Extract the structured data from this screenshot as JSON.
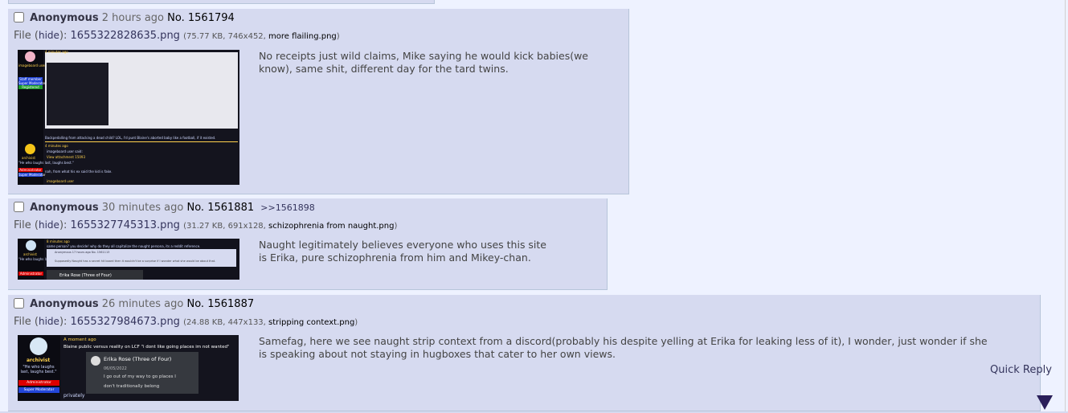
{
  "posts": [
    {
      "name": "Anonymous",
      "date": "2 hours ago",
      "no_label": "No.",
      "number": "1561794",
      "file_label": "File",
      "hide": "hide",
      "filename": "1655322828635.png",
      "size": "75.77 KB",
      "dims": "746x452",
      "orig": "more flailing.png",
      "comment": "No receipts just wild claims, Mike saying he would kick babies(we know), same shit, different day for the tard twins."
    },
    {
      "name": "Anonymous",
      "date": "30 minutes ago",
      "no_label": "No.",
      "number": "1561881",
      "backlink": ">>1561898",
      "file_label": "File",
      "hide": "hide",
      "filename": "1655327745313.png",
      "size": "31.27 KB",
      "dims": "691x128",
      "orig": "schizophrenia from naught.png",
      "comment": "Naught legitimately believes everyone who uses this site is Erika, pure schizophrenia from him and Mikey-chan."
    },
    {
      "name": "Anonymous",
      "date": "26 minutes ago",
      "no_label": "No.",
      "number": "1561887",
      "file_label": "File",
      "hide": "hide",
      "filename": "1655327984673.png",
      "size": "24.88 KB",
      "dims": "447x133",
      "orig": "stripping context.png",
      "comment": "Samefag, here we see naught strip context from a discord(probably his despite yelling at Erika for leaking less of it), I wonder, just wonder if she is speaking about not staying in hugboxes that cater to her own views."
    }
  ],
  "thumb1": {
    "time": "4 minutes ago",
    "user": "imageboard user",
    "line1": "Backpedalling from attacking a dead child? LOL, I'd punt Blaine's aborted baby like a football, if it existed.",
    "user2": "archivist",
    "quote": "\"He who laughs last, laughs best.\"",
    "badge_admin": "Administrator",
    "badge_mod": "Super Moderator",
    "badge_staff": "Staff member",
    "badge_reg": "Registered",
    "time2": "4 minutes ago",
    "said": "imageboard user said:",
    "view": "View attachment 15093",
    "line2": "nah, from what his ex said the kid is fake.",
    "footer": "imageboard user"
  },
  "thumb2": {
    "time": "8 minutes ago",
    "line1": "same person? you decide! why do they all capitalize the naught persona, its a reddit reference.",
    "user": "archivist",
    "quote": "\"He who laughs last, laughs best.\"",
    "badge_admin": "Administrator",
    "post_meta": "Anonymous 17 hours ago No. 1561113",
    "post_text": "Supposedly Naught has a secret hit board then it wouldn't be a surprise if I wonder what she would be about that.",
    "card": "Erika Rose (Three of Four)"
  },
  "thumb3": {
    "time": "A moment ago",
    "title": "Blaine public versus reality on LCF \"i dont like going places im not wanted\"",
    "user": "archivist",
    "quote": "\"He who laughs last, laughs best.\"",
    "badge_admin": "Administrator",
    "badge_mod": "Super Moderator",
    "card_name": "Erika Rose (Three of Four)",
    "card_date": "06/05/2022",
    "card_line1": "I go out of my way to go places I",
    "card_line2": "don't traditionally belong",
    "privately": "privately"
  },
  "quick_reply": "Quick Reply",
  "colors": {
    "post_bg": "#d6daf0",
    "post_border": "#b7c5d9",
    "page_bg": "#eef2ff",
    "link": "#34345c"
  }
}
